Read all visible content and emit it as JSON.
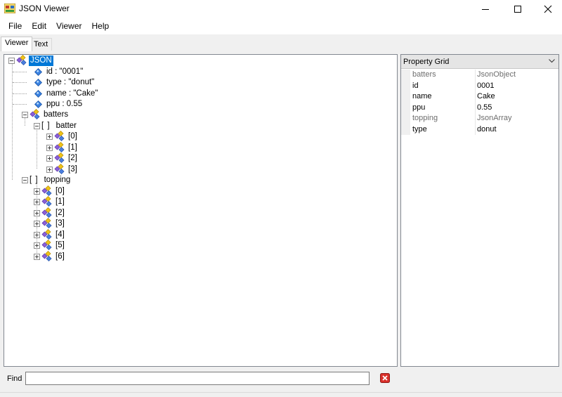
{
  "window": {
    "title": "JSON Viewer",
    "controls": [
      "minimize",
      "maximize",
      "close"
    ]
  },
  "menu": {
    "items": [
      "File",
      "Edit",
      "Viewer",
      "Help"
    ]
  },
  "tabs": [
    {
      "label": "Viewer",
      "active": true
    },
    {
      "label": "Text",
      "active": false
    }
  ],
  "tree": {
    "root": "JSON",
    "props": [
      "id : \"0001\"",
      "type : \"donut\"",
      "name : \"Cake\"",
      "ppu : 0.55"
    ],
    "batters": {
      "label": "batters",
      "array_bracket": "[ ]",
      "array_label": "batter",
      "items": [
        "[0]",
        "[1]",
        "[2]",
        "[3]"
      ]
    },
    "topping": {
      "array_bracket": "[ ]",
      "label": "topping",
      "items": [
        "[0]",
        "[1]",
        "[2]",
        "[3]",
        "[4]",
        "[5]",
        "[6]"
      ]
    }
  },
  "property_grid": {
    "title": "Property Grid",
    "rows": [
      {
        "name": "batters",
        "value": "JsonObject",
        "readonly": true
      },
      {
        "name": "id",
        "value": "0001",
        "readonly": false
      },
      {
        "name": "name",
        "value": "Cake",
        "readonly": false
      },
      {
        "name": "ppu",
        "value": "0.55",
        "readonly": false
      },
      {
        "name": "topping",
        "value": "JsonArray",
        "readonly": true
      },
      {
        "name": "type",
        "value": "donut",
        "readonly": false
      }
    ]
  },
  "find": {
    "label": "Find",
    "value": ""
  },
  "colors": {
    "selection": "#0078d7",
    "readonly_text": "#6d6d6d",
    "clear_button": "#d9302b"
  }
}
